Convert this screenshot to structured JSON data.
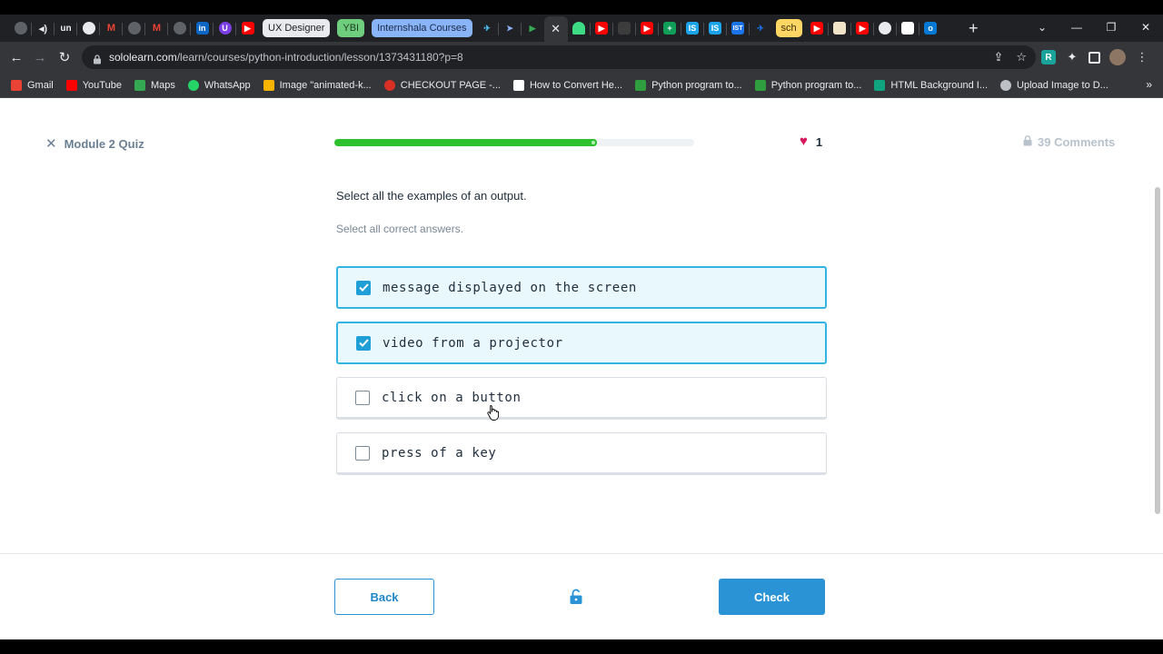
{
  "browser": {
    "tab_pills": [
      {
        "label": "UX Designer",
        "bg": "#e8eaed",
        "fg": "#202124"
      },
      {
        "label": "YBI",
        "bg": "#6fce7e",
        "fg": "#1f3d23"
      },
      {
        "label": "Internshala Courses",
        "bg": "#8ab4f8",
        "fg": "#1a2a4a"
      },
      {
        "label": "sch",
        "bg": "#fdd663",
        "fg": "#3c2f00"
      }
    ],
    "url_domain": "sololearn.com",
    "url_path": "/learn/courses/python-introduction/lesson/1373431180?p=8",
    "bookmarks": [
      {
        "label": "Gmail",
        "color": "#ea4335"
      },
      {
        "label": "YouTube",
        "color": "#ff0000"
      },
      {
        "label": "Maps",
        "color": "#34a853"
      },
      {
        "label": "WhatsApp",
        "color": "#25d366"
      },
      {
        "label": "Image \"animated-k...",
        "color": "#f6b400"
      },
      {
        "label": "CHECKOUT PAGE -...",
        "color": "#d93025"
      },
      {
        "label": "How to Convert He...",
        "color": "#ffffff"
      },
      {
        "label": "Python program to...",
        "color": "#2e9e3f"
      },
      {
        "label": "Python program to...",
        "color": "#2e9e3f"
      },
      {
        "label": "HTML Background I...",
        "color": "#0fa47f"
      },
      {
        "label": "Upload Image to D...",
        "color": "#bdc1c6"
      }
    ],
    "bookmarks_more": "»",
    "new_tab": "+"
  },
  "quiz": {
    "title": "Module 2 Quiz",
    "progress": 0.73,
    "hearts": "1",
    "comments": "39 Comments",
    "question": "Select all the examples of an output.",
    "hint": "Select all correct answers.",
    "answers": [
      {
        "text": "message displayed on the screen",
        "selected": true
      },
      {
        "text": "video from a projector",
        "selected": true
      },
      {
        "text": "click on a button",
        "selected": false
      },
      {
        "text": "press of a key",
        "selected": false
      }
    ],
    "back_label": "Back",
    "check_label": "Check"
  },
  "colors": {
    "accent": "#2a93d5",
    "progress": "#2ec22e",
    "heart": "#d6185c",
    "selected_bg": "#e9f8fd"
  }
}
